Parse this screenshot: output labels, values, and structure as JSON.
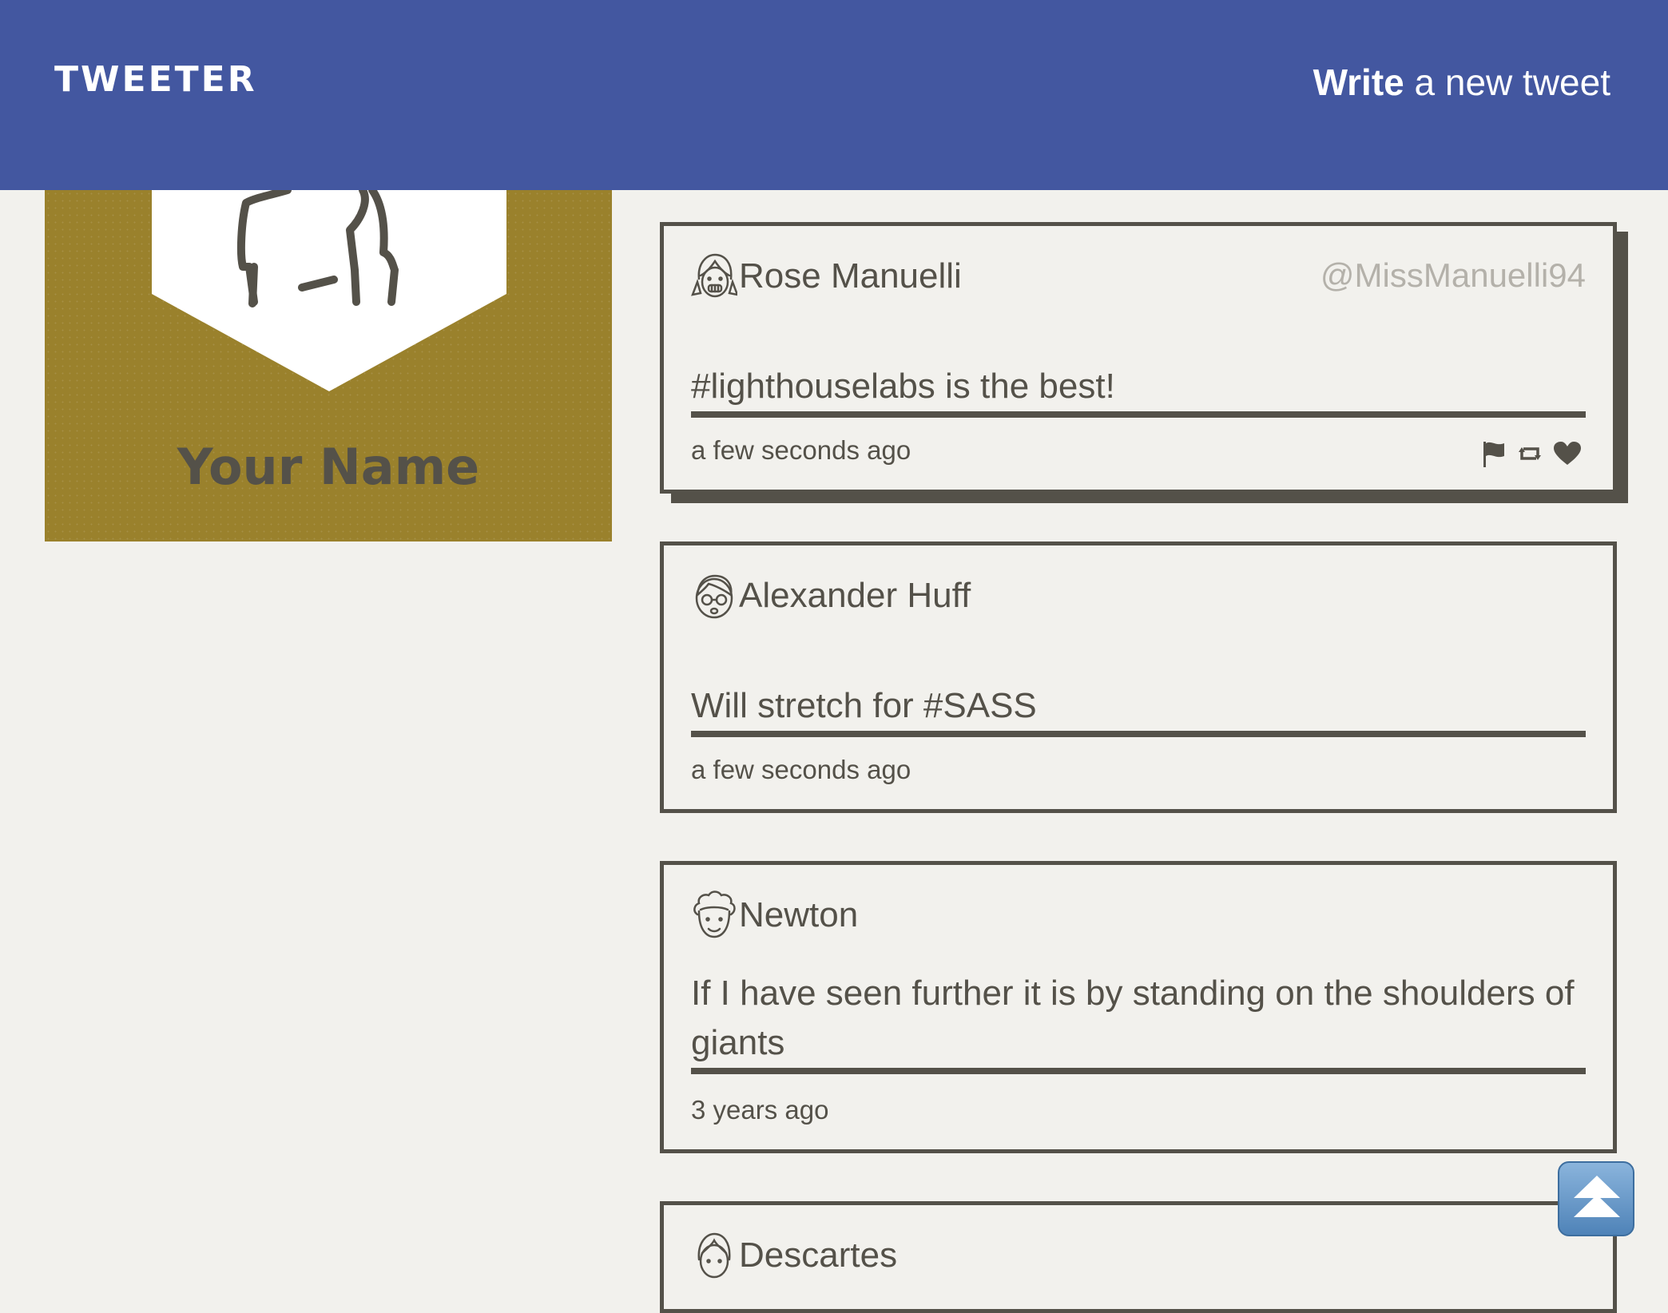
{
  "header": {
    "brand": "TWEETER",
    "compose_bold": "Write",
    "compose_rest": " a new tweet"
  },
  "profile": {
    "name": "Your Name",
    "avatar_icon": "user-avatar-icon"
  },
  "tweets": [
    {
      "name": "Rose Manuelli",
      "handle": "@MissManuelli94",
      "content": "#lighthouselabs is the best!",
      "time": "a few seconds ago",
      "avatar_icon": "girl-face-icon"
    },
    {
      "name": "Alexander Huff",
      "handle": "",
      "content": "Will stretch for #SASS",
      "time": "a few seconds ago",
      "avatar_icon": "glasses-face-icon"
    },
    {
      "name": "Newton",
      "handle": "",
      "content": "If I have seen further it is by standing on the shoulders of giants",
      "time": "3 years ago",
      "avatar_icon": "curly-hair-face-icon"
    },
    {
      "name": "Descartes",
      "handle": "",
      "content": "",
      "time": "",
      "avatar_icon": "face-icon"
    }
  ],
  "actions": [
    "flag-icon",
    "retweet-icon",
    "heart-icon"
  ],
  "colors": {
    "nav": "#4357a0",
    "profile_bg": "#9a812c",
    "text": "#545149",
    "page_bg": "#f2f1ed",
    "handle": "#b4b1aa"
  }
}
